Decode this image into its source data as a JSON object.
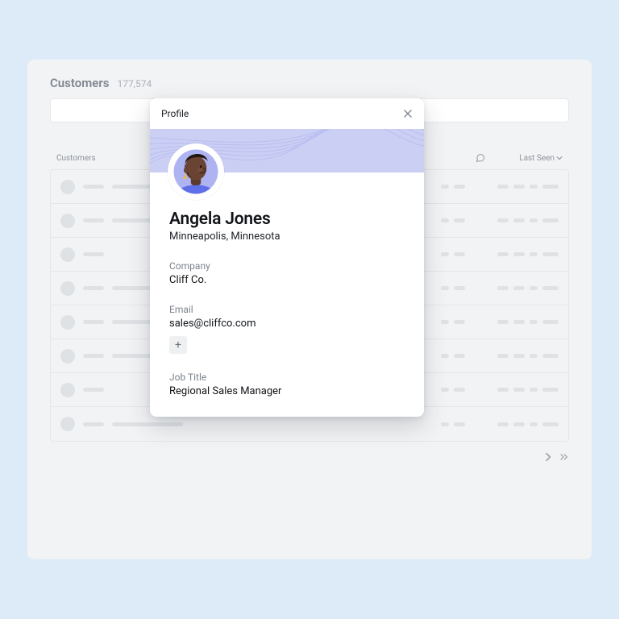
{
  "page": {
    "title": "Customers",
    "count": "177,574"
  },
  "table": {
    "header_left": "Customers",
    "header_last_seen": "Last Seen"
  },
  "profile": {
    "header": "Profile",
    "name": "Angela Jones",
    "location": "Minneapolis, Minnesota",
    "company_label": "Company",
    "company_value": "Cliff Co.",
    "email_label": "Email",
    "email_value": "sales@cliffco.com",
    "add_email_label": "+",
    "job_label": "Job Title",
    "job_value": "Regional Sales Manager"
  }
}
